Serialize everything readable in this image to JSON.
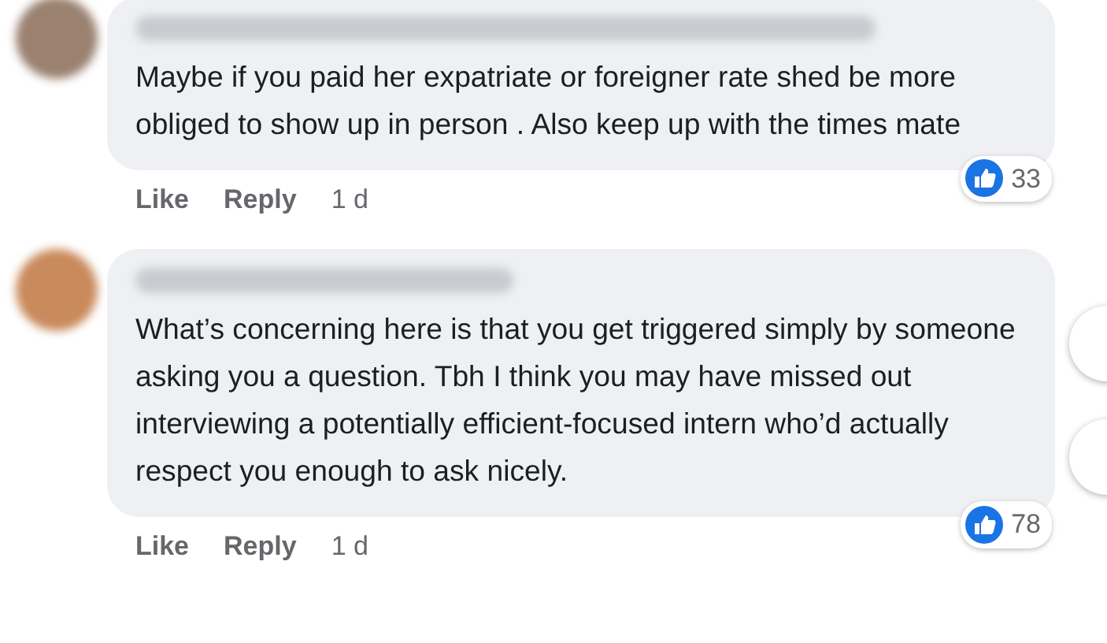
{
  "comments": [
    {
      "text": "Maybe if you paid her expatriate or foreigner rate shed be more obliged to show up in person . Also keep up with the times mate",
      "actions": [
        "Like",
        "Reply"
      ],
      "time": "1 d",
      "reactions": "33"
    },
    {
      "text": "What’s concerning here is that you get triggered simply by someone asking you a question. Tbh I think you may have missed out interviewing a potentially efficient-focused intern who’d actually respect you enough to ask nicely.",
      "actions": [
        "Like",
        "Reply"
      ],
      "time": "1 d",
      "reactions": "78"
    }
  ]
}
